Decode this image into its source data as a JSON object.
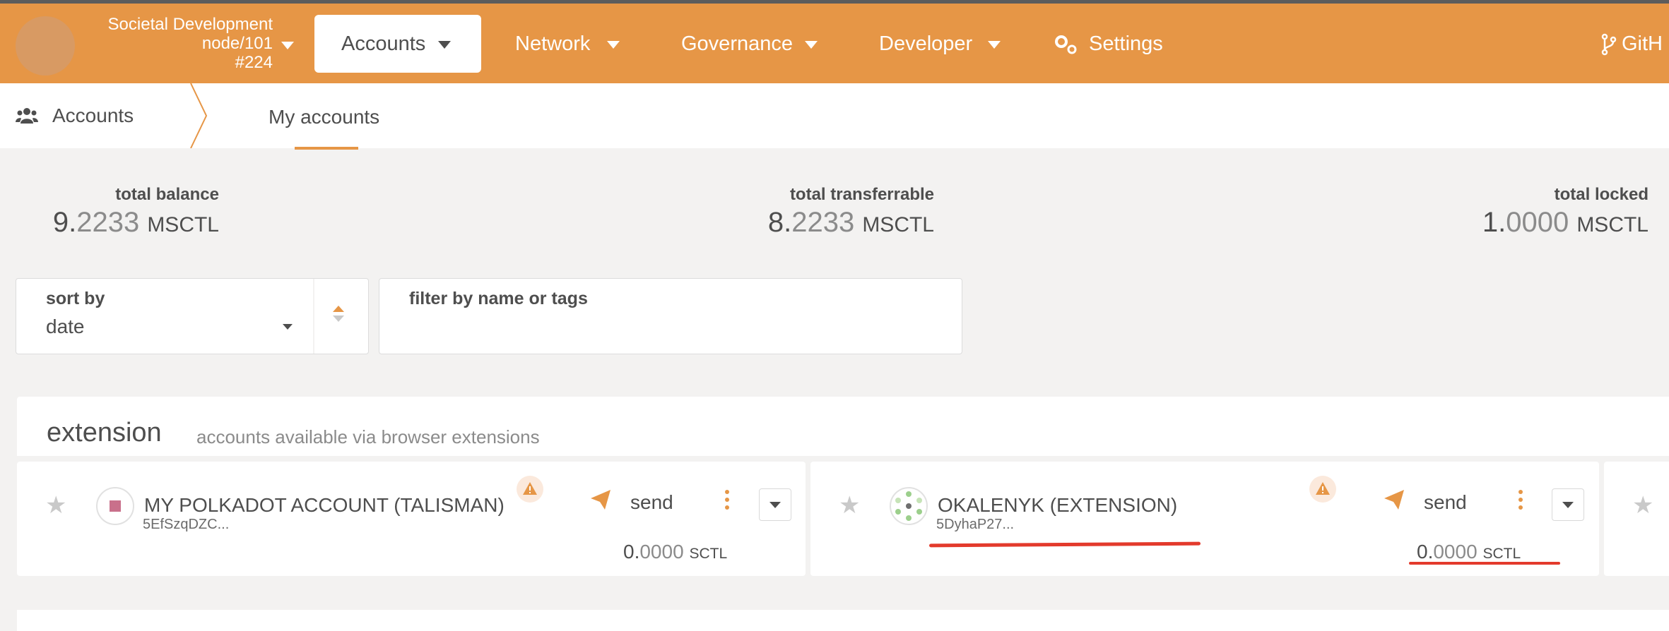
{
  "chain": {
    "name": "Societal Development",
    "node": "node/101",
    "block": "#224"
  },
  "nav": {
    "accounts": "Accounts",
    "network": "Network",
    "governance": "Governance",
    "developer": "Developer",
    "settings": "Settings",
    "github": "GitH"
  },
  "subnav": {
    "section": "Accounts",
    "tab": "My accounts"
  },
  "summary": {
    "total_balance": {
      "label": "total balance",
      "int": "9.",
      "dec": "2233",
      "unit": "MSCTL"
    },
    "total_transferrable": {
      "label": "total transferrable",
      "int": "8.",
      "dec": "2233",
      "unit": "MSCTL"
    },
    "total_locked": {
      "label": "total locked",
      "int": "1.",
      "dec": "0000",
      "unit": "MSCTL"
    }
  },
  "sort": {
    "label": "sort by",
    "value": "date"
  },
  "filter": {
    "label": "filter by name or tags"
  },
  "section": {
    "title": "extension",
    "desc": "accounts available via browser extensions"
  },
  "accounts": [
    {
      "name": "MY POLKADOT ACCOUNT (TALISMAN)",
      "address": "5EfSzqDZC...",
      "send": "send",
      "int": "0.",
      "dec": "0000",
      "unit": "SCTL"
    },
    {
      "name": "OKALENYK (EXTENSION)",
      "address": "5DyhaP27...",
      "send": "send",
      "int": "0.",
      "dec": "0000",
      "unit": "SCTL"
    }
  ],
  "colors": {
    "accent": "#e69646",
    "highlight": "#e33a2c"
  }
}
